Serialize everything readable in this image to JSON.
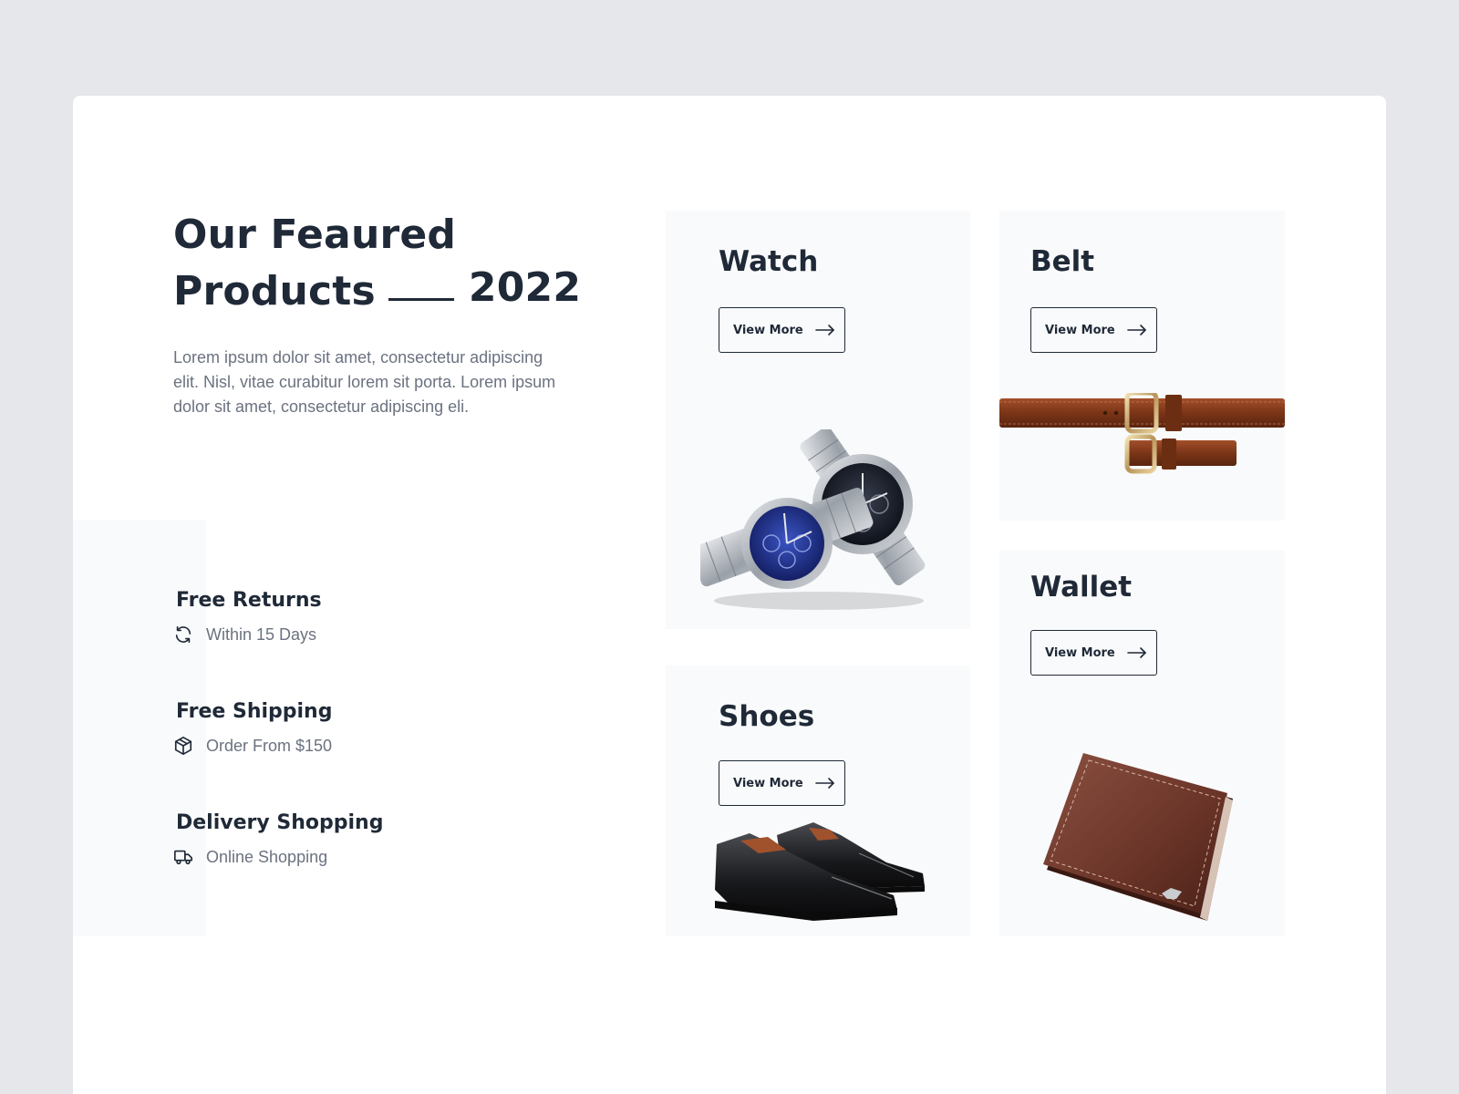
{
  "hero": {
    "title_line1": "Our Feaured",
    "title_line2": "Products",
    "title_year": "2022",
    "description": "Lorem ipsum dolor sit amet, consectetur adipiscing elit. Nisl, vitae curabitur lorem sit porta. Lorem ipsum dolor sit amet, consectetur adipiscing eli."
  },
  "features": [
    {
      "title": "Free Returns",
      "subtitle": "Within 15 Days",
      "icon": "refresh-icon"
    },
    {
      "title": "Free Shipping",
      "subtitle": "Order From $150",
      "icon": "box-icon"
    },
    {
      "title": "Delivery Shopping",
      "subtitle": "Online Shopping",
      "icon": "truck-icon"
    }
  ],
  "products": {
    "watch": {
      "name": "Watch",
      "button": "View More"
    },
    "belt": {
      "name": "Belt",
      "button": "View More"
    },
    "shoes": {
      "name": "Shoes",
      "button": "View More"
    },
    "wallet": {
      "name": "Wallet",
      "button": "View More"
    }
  },
  "colors": {
    "page_background": "#e5e7eb",
    "card_background": "#ffffff",
    "tile_background": "#f9fafb",
    "heading": "#1f2937",
    "body_text": "#6b7280"
  }
}
